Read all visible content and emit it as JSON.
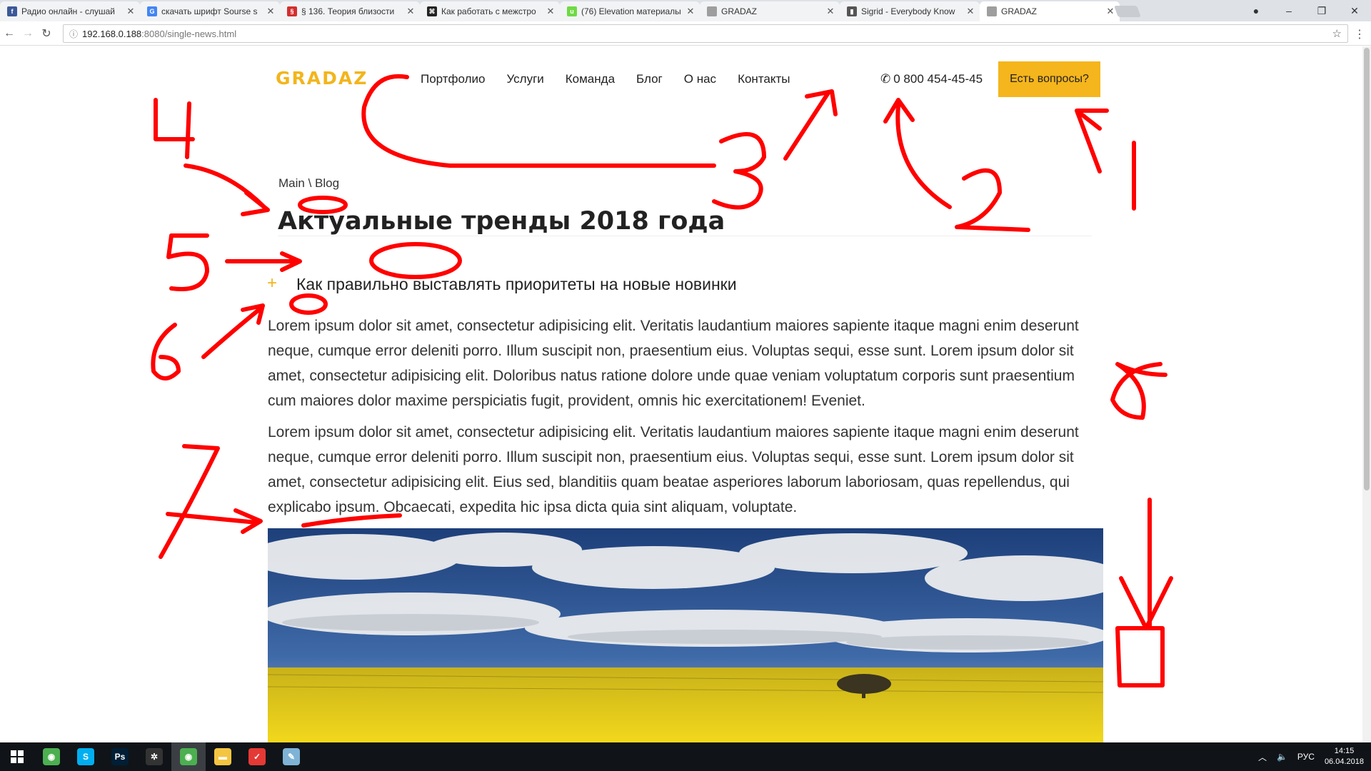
{
  "browser": {
    "tabs": [
      {
        "title": "Радио онлайн - слушай",
        "icon": "facebook-icon",
        "color": "#3b5998",
        "glyph": "f"
      },
      {
        "title": "скачать шрифт Sourse s",
        "icon": "google-icon",
        "color": "#4285f4",
        "glyph": "G"
      },
      {
        "title": "§ 136. Теория близости",
        "icon": "red-site-icon",
        "color": "#d32f2f",
        "glyph": "§"
      },
      {
        "title": "Как работать с межстро",
        "icon": "command-icon",
        "color": "#222222",
        "glyph": "⌘"
      },
      {
        "title": "(76) Elevation материалы",
        "icon": "upwork-icon",
        "color": "#6fda44",
        "glyph": "u"
      },
      {
        "title": "GRADAZ",
        "icon": "page-icon",
        "color": "#9e9e9e",
        "glyph": ""
      },
      {
        "title": "Sigrid - Everybody Know",
        "icon": "bars-icon",
        "color": "#555555",
        "glyph": "▮"
      },
      {
        "title": "GRADAZ",
        "icon": "page-icon",
        "color": "#9e9e9e",
        "glyph": ""
      }
    ],
    "active_tab": 7,
    "url_host": "192.168.0.188",
    "url_path": ":8080/single-news.html"
  },
  "site": {
    "logo": "GRADAZ",
    "nav": [
      "Портфолио",
      "Услуги",
      "Команда",
      "Блог",
      "О нас",
      "Контакты"
    ],
    "phone": "0 800 454-45-45",
    "ask_button": "Есть вопросы?",
    "accent_color": "#f5b51c"
  },
  "article": {
    "breadcrumb": "Main \\ Blog",
    "title": "Актуальные тренды 2018 года",
    "subtitle": "Как правильно выставлять приоритеты на новые новинки",
    "paragraph1": "Lorem ipsum dolor sit amet, consectetur adipisicing elit. Veritatis laudantium maiores sapiente itaque magni enim deserunt neque, cumque error deleniti porro. Illum suscipit non, praesentium eius. Voluptas sequi, esse sunt. Lorem ipsum dolor sit amet, consectetur adipisicing elit. Doloribus natus ratione dolore unde quae veniam voluptatum corporis sunt praesentium cum maiores dolor maxime perspiciatis fugit, provident, omnis hic exercitationem! Eveniet.",
    "paragraph2": "Lorem ipsum dolor sit amet, consectetur adipisicing elit. Veritatis laudantium maiores sapiente itaque magni enim deserunt neque, cumque error deleniti porro. Illum suscipit non, praesentium eius. Voluptas sequi, esse sunt. Lorem ipsum dolor sit amet, consectetur adipisicing elit. Eius sed, blanditiis quam beatae asperiores laborum laboriosam, quas repellendus, qui explicabo ipsum. Obcaecati, expedita hic ipsa dicta quia sint aliquam, voluptate."
  },
  "annotations": [
    "1",
    "2",
    "3",
    "4",
    "5",
    "6",
    "7",
    "8"
  ],
  "taskbar": {
    "apps": [
      {
        "name": "chrome-icon",
        "color": "#4caf50",
        "glyph": "◉"
      },
      {
        "name": "skype-icon",
        "color": "#00aff0",
        "glyph": "S"
      },
      {
        "name": "photoshop-icon",
        "color": "#001e36",
        "glyph": "Ps"
      },
      {
        "name": "app-icon",
        "color": "#333333",
        "glyph": "✲"
      },
      {
        "name": "chrome-icon",
        "color": "#4caf50",
        "glyph": "◉"
      },
      {
        "name": "folder-icon",
        "color": "#f4c542",
        "glyph": "▬"
      },
      {
        "name": "todo-icon",
        "color": "#e53935",
        "glyph": "✓"
      },
      {
        "name": "notepad-icon",
        "color": "#7fb3d5",
        "glyph": "✎"
      }
    ],
    "active_app": 4,
    "lang": "РУС",
    "time": "14:15",
    "date": "06.04.2018"
  }
}
